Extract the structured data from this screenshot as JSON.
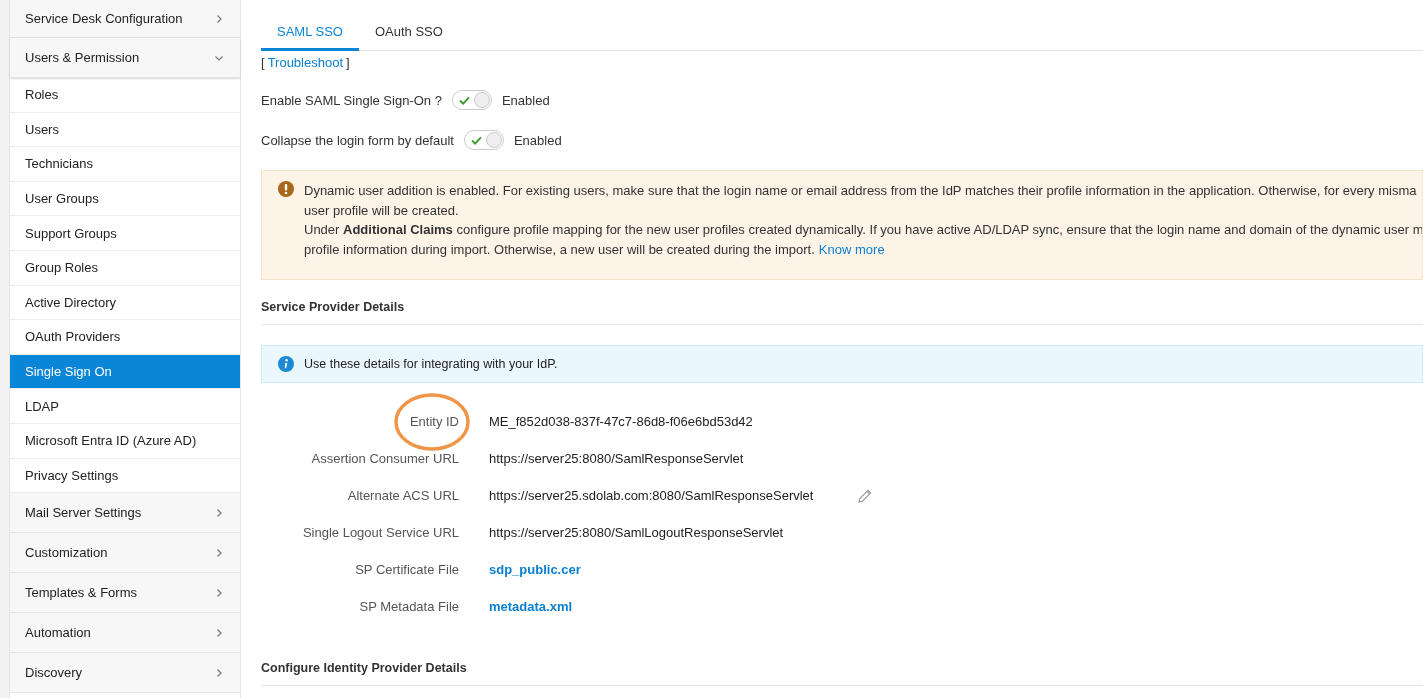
{
  "sidebar": {
    "items": [
      {
        "label": "Service Desk Configuration",
        "kind": "group",
        "expanded": false,
        "selected": false
      },
      {
        "label": "Users & Permission",
        "kind": "group",
        "expanded": true,
        "selected": false,
        "children": [
          {
            "label": "Roles",
            "selected": false
          },
          {
            "label": "Users",
            "selected": false
          },
          {
            "label": "Technicians",
            "selected": false
          },
          {
            "label": "User Groups",
            "selected": false
          },
          {
            "label": "Support Groups",
            "selected": false
          },
          {
            "label": "Group Roles",
            "selected": false
          },
          {
            "label": "Active Directory",
            "selected": false
          },
          {
            "label": "OAuth Providers",
            "selected": false
          },
          {
            "label": "Single Sign On",
            "selected": true
          },
          {
            "label": "LDAP",
            "selected": false
          },
          {
            "label": "Microsoft Entra ID (Azure AD)",
            "selected": false
          },
          {
            "label": "Privacy Settings",
            "selected": false
          }
        ]
      },
      {
        "label": "Mail Server Settings",
        "kind": "group",
        "expanded": false,
        "selected": false
      },
      {
        "label": "Customization",
        "kind": "group",
        "expanded": false,
        "selected": false
      },
      {
        "label": "Templates & Forms",
        "kind": "group",
        "expanded": false,
        "selected": false
      },
      {
        "label": "Automation",
        "kind": "group",
        "expanded": false,
        "selected": false
      },
      {
        "label": "Discovery",
        "kind": "group",
        "expanded": false,
        "selected": false
      }
    ]
  },
  "tabs": [
    {
      "label": "SAML SSO",
      "selected": true
    },
    {
      "label": "OAuth SSO",
      "selected": false
    }
  ],
  "troubleshoot": {
    "open": "[",
    "label": "Troubleshoot",
    "close": "]"
  },
  "toggles": [
    {
      "label": "Enable SAML Single Sign-On ?",
      "on": true,
      "state": "Enabled"
    },
    {
      "label": "Collapse the login form by default",
      "on": true,
      "state": "Enabled"
    }
  ],
  "notice": {
    "lines": [
      "Dynamic user addition is enabled. For existing users, make sure that the login name or email address from the IdP matches their profile information in the application. Otherwise, for every misma",
      "user profile will be created.",
      "Under **Additional Claims** configure profile mapping for the new user profiles created dynamically. If you have active AD/LDAP sync, ensure that the login name and domain of the dynamic user m",
      "profile information during import. Otherwise, a new user will be created during the import."
    ],
    "link": "Know more"
  },
  "service_provider": {
    "heading": "Service Provider Details",
    "info": "Use these details for integrating with your IdP.",
    "rows": [
      {
        "label": "Entity ID",
        "value": "ME_f852d038-837f-47c7-86d8-f06e6bd53d42",
        "kind": "text",
        "editable": false
      },
      {
        "label": "Assertion Consumer URL",
        "value": "https://server25:8080/SamlResponseServlet",
        "kind": "text",
        "editable": false
      },
      {
        "label": "Alternate ACS URL",
        "value": "https://server25.sdolab.com:8080/SamlResponseServlet",
        "kind": "text",
        "editable": true
      },
      {
        "label": "Single Logout Service URL",
        "value": "https://server25:8080/SamlLogoutResponseServlet",
        "kind": "text",
        "editable": false
      },
      {
        "label": "SP Certificate File",
        "value": "sdp_public.cer",
        "kind": "link",
        "editable": false
      },
      {
        "label": "SP Metadata File",
        "value": "metadata.xml",
        "kind": "link",
        "editable": false
      }
    ]
  },
  "identity_provider": {
    "heading": "Configure Identity Provider Details"
  }
}
